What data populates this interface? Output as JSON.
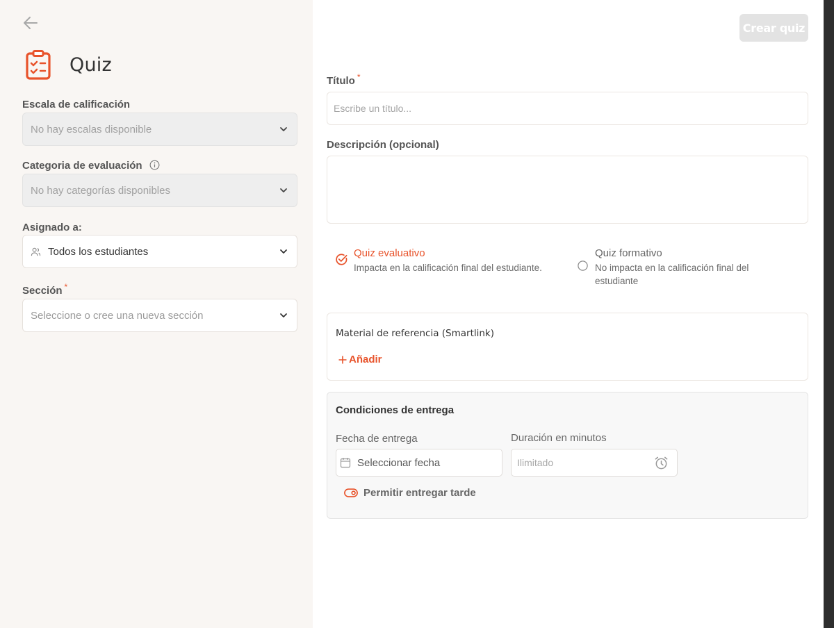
{
  "header": {
    "title": "Quiz",
    "create_button": "Crear quiz"
  },
  "sidebar": {
    "grading_scale": {
      "label": "Escala de calificación",
      "value": "No hay escalas disponible"
    },
    "evaluation_category": {
      "label": "Categoria de evaluación",
      "value": "No hay categorías disponibles"
    },
    "assigned_to": {
      "label": "Asignado a:",
      "value": "Todos los estudiantes"
    },
    "section": {
      "label": "Sección",
      "required_mark": "*",
      "placeholder": "Seleccione o cree una nueva sección"
    }
  },
  "form": {
    "title": {
      "label": "Título",
      "required_mark": "*",
      "placeholder": "Escribe un título..."
    },
    "description": {
      "label": "Descripción (opcional)",
      "value": ""
    },
    "quiz_type": {
      "evaluative": {
        "title": "Quiz evaluativo",
        "desc": "Impacta en la calificación final del estudiante.",
        "selected": true
      },
      "formative": {
        "title": "Quiz formativo",
        "desc_line1": "No impacta en la calificación final del",
        "desc_line2": "estudiante",
        "selected": false
      }
    },
    "reference_material": {
      "title": "Material de referencia (Smartlink)",
      "add_label": "Añadir"
    },
    "delivery": {
      "title": "Condiciones de entrega",
      "date_label": "Fecha de entrega",
      "date_placeholder": "Seleccionar fecha",
      "duration_label": "Duración en minutos",
      "duration_placeholder": "Ilimitado",
      "late_toggle_label": "Permitir entregar tarde"
    }
  },
  "colors": {
    "accent": "#e8532b",
    "sidebar_bg": "#f9f6f3",
    "disabled_bg": "#eeeeee"
  }
}
